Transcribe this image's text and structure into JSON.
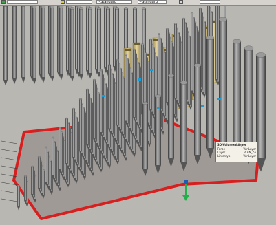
{
  "toolbar": {
    "field_1": "",
    "field_2": "",
    "field_3": "~Standard",
    "field_4": "~Standard",
    "field_5": ""
  },
  "tooltip": {
    "title": "3D-Volumenkörper",
    "rows": [
      {
        "label": "Farbe",
        "value": "VonLayer"
      },
      {
        "label": "Layer",
        "value": "PLAN_ZA"
      },
      {
        "label": "Linientyp",
        "value": "VonLayer"
      }
    ]
  },
  "colors": {
    "background": "#b8b7b1",
    "pipe_dark": "#4c4c4c",
    "pipe_light": "#b2b2b2",
    "wood_pipe": "#c8b67d",
    "frame_red": "#d81f1f",
    "marker_blue": "#1e9ad2",
    "axis_green": "#22b04a"
  },
  "icons": [
    "ucs-axis-icon"
  ]
}
